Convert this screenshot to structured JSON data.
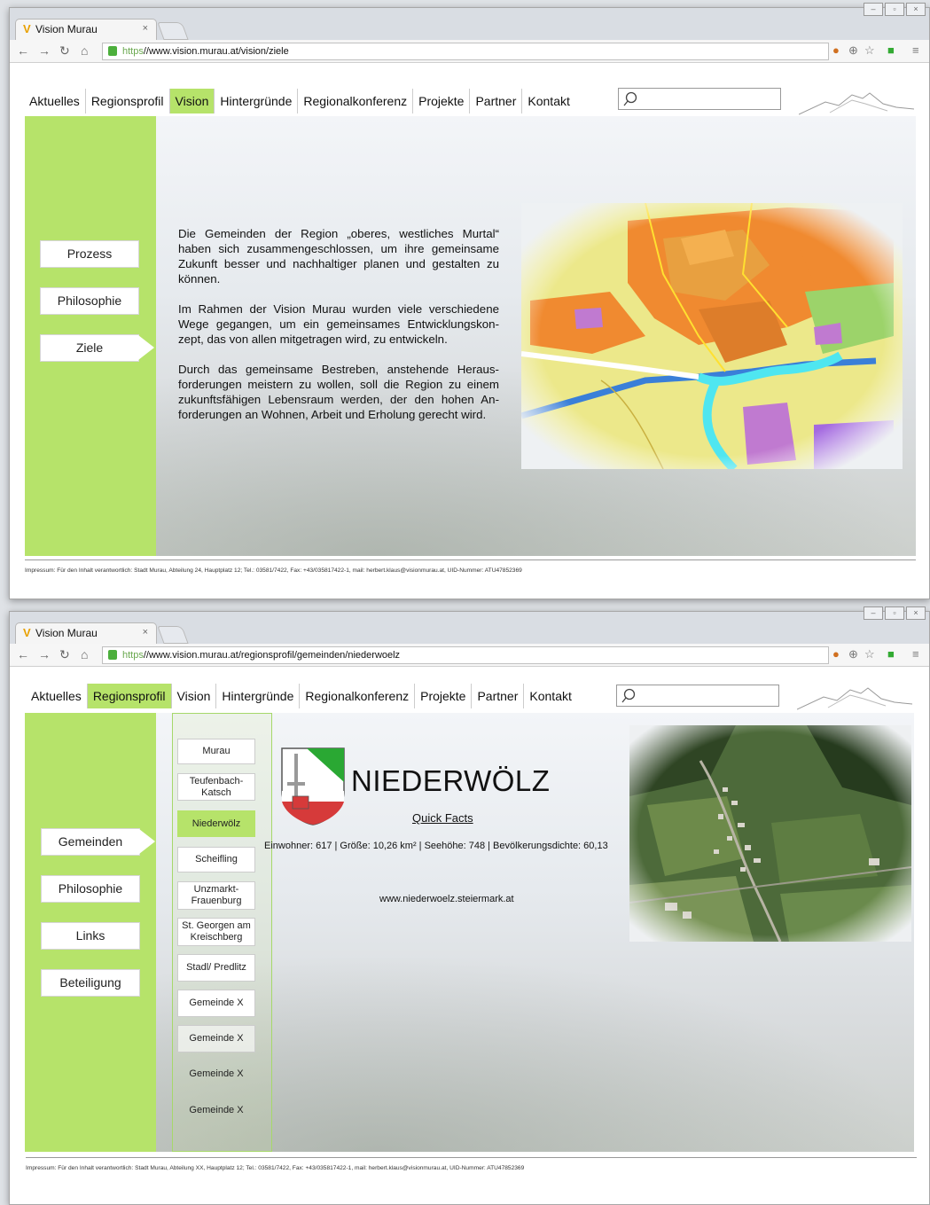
{
  "window1": {
    "tab_title": "Vision Murau",
    "url_scheme": "https",
    "url_rest": "//www.vision.murau.at/vision/ziele",
    "menu": [
      {
        "label": "Aktuelles",
        "active": false
      },
      {
        "label": "Regionsprofil",
        "active": false
      },
      {
        "label": "Vision",
        "active": true
      },
      {
        "label": "Hintergründe",
        "active": false
      },
      {
        "label": "Regionalkonferenz",
        "active": false
      },
      {
        "label": "Projekte",
        "active": false
      },
      {
        "label": "Partner",
        "active": false
      },
      {
        "label": "Kontakt",
        "active": false
      }
    ],
    "side_buttons": [
      "Prozess",
      "Philosophie",
      "Ziele"
    ],
    "side_active": "Ziele",
    "paragraphs": [
      "Die Gemeinden der Region „oberes, westliches Murtal“ haben sich zusammengeschlossen, um ihre gemeinsame Zukunft besser und nachhaltiger planen und gestalten zu können.",
      "Im Rahmen der Vision Murau wurden viele verschiedene Wege gegangen, um ein gemeinsames Entwicklungskon-zept, das von allen mitgetragen wird, zu entwickeln.",
      "Durch das gemeinsame Bestreben, anstehende Heraus-forderungen meistern zu wollen, soll die Region zu einem zukunftsfähigen Lebensraum werden, der den hohen An-forderungen an Wohnen, Arbeit und Erholung gerecht wird."
    ],
    "footer": "Impressum: Für den Inhalt verantwortlich: Stadt Murau, Abteilung 24, Hauptplatz 12; Tel.: 03581/7422, Fax: +43/035817422-1, mail: herbert.klaus@visionmurau.at, UID-Nummer: ATU47852369"
  },
  "window2": {
    "tab_title": "Vision Murau",
    "url_scheme": "https",
    "url_rest": "//www.vision.murau.at/regionsprofil/gemeinden/niederwoelz",
    "menu": [
      {
        "label": "Aktuelles",
        "active": false
      },
      {
        "label": "Regionsprofil",
        "active": true
      },
      {
        "label": "Vision",
        "active": false
      },
      {
        "label": "Hintergründe",
        "active": false
      },
      {
        "label": "Regionalkonferenz",
        "active": false
      },
      {
        "label": "Projekte",
        "active": false
      },
      {
        "label": "Partner",
        "active": false
      },
      {
        "label": "Kontakt",
        "active": false
      }
    ],
    "side_buttons": [
      "Gemeinden",
      "Philosophie",
      "Links",
      "Beteiligung"
    ],
    "side_active": "Gemeinden",
    "sub_menu": [
      "Murau",
      "Teufenbach-Katsch",
      "Niederwölz",
      "Scheifling",
      "Unzmarkt-Frauenburg",
      "St. Georgen am Kreischberg",
      "Stadl/ Predlitz",
      "Gemeinde X",
      "Gemeinde X",
      "Gemeinde X",
      "Gemeinde X"
    ],
    "sub_active": "Niederwölz",
    "town_name": "NIEDERWÖLZ",
    "quick_facts_label": "Quick Facts",
    "facts": "Einwohner: 617 | Größe: 10,26 km² | Seehöhe: 748 | Bevölkerungsdichte: 60,13",
    "website": "www.niederwoelz.steiermark.at",
    "footer": "Impressum: Für den Inhalt verantwortlich: Stadt Murau, Abteilung XX, Hauptplatz 12; Tel.: 03581/7422, Fax: +43/035817422-1, mail: herbert.klaus@visionmurau.at, UID-Nummer: ATU47852369"
  },
  "colors": {
    "accent_green": "#b6e36a",
    "active_menu": "#b6e36a"
  },
  "icons": [
    "back-icon",
    "forward-icon",
    "reload-icon",
    "home-icon",
    "lock-icon",
    "search-icon",
    "star-icon",
    "zoom-icon",
    "menu-icon",
    "coat-of-arms-icon",
    "mountain-logo-icon"
  ]
}
